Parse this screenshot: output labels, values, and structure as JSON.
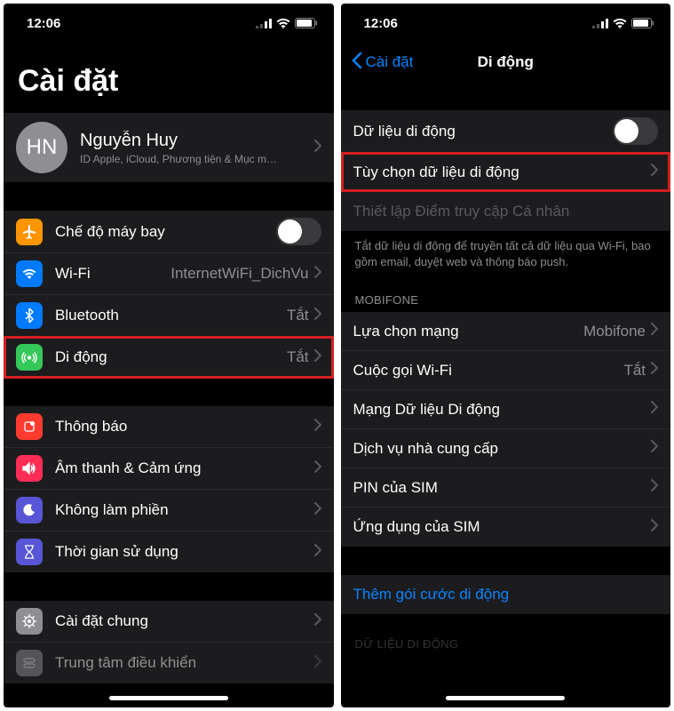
{
  "status": {
    "time": "12:06"
  },
  "left": {
    "title": "Cài đặt",
    "profile": {
      "initials": "HN",
      "name": "Nguyễn Huy",
      "subtitle": "ID Apple, iCloud, Phương tiện & Mục m…"
    },
    "group1": {
      "airplane": "Chế độ máy bay",
      "wifi": {
        "label": "Wi-Fi",
        "value": "InternetWiFi_DichVu"
      },
      "bluetooth": {
        "label": "Bluetooth",
        "value": "Tắt"
      },
      "cellular": {
        "label": "Di động",
        "value": "Tắt"
      }
    },
    "group2": {
      "notifications": "Thông báo",
      "sounds": "Âm thanh & Cảm ứng",
      "dnd": "Không làm phiền",
      "screentime": "Thời gian sử dụng"
    },
    "group3": {
      "general": "Cài đặt chung",
      "control": "Trung tâm điều khiển"
    }
  },
  "right": {
    "back": "Cài đặt",
    "title": "Di động",
    "group1": {
      "data": "Dữ liệu di động",
      "options": "Tùy chọn dữ liệu di động",
      "hotspot": "Thiết lập Điểm truy cập Cá nhân"
    },
    "footer1": "Tắt dữ liệu di động để truyền tất cả dữ liệu qua Wi-Fi, bao gồm email, duyệt web và thông báo push.",
    "section2Header": "MOBIFONE",
    "group2": {
      "network": {
        "label": "Lựa chọn mạng",
        "value": "Mobifone"
      },
      "wificalling": {
        "label": "Cuộc gọi Wi-Fi",
        "value": "Tắt"
      },
      "datanet": "Mạng Dữ liệu Di động",
      "carrier": "Dịch vụ nhà cung cấp",
      "simpin": "PIN của SIM",
      "simapps": "Ứng dụng của SIM"
    },
    "addplan": "Thêm gói cước di động",
    "footer2": "DỮ LIỆU DI ĐỘNG"
  }
}
